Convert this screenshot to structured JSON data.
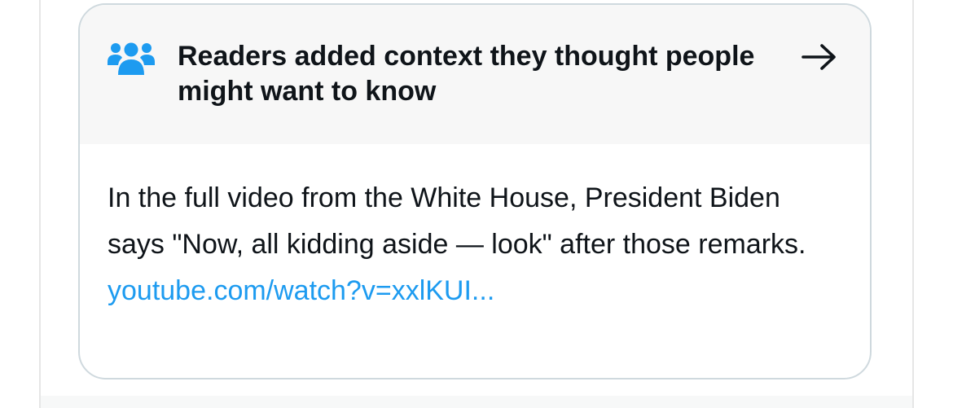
{
  "note": {
    "header_title": "Readers added context they thought people might want to know",
    "header_icon": "people-group-icon",
    "arrow_icon": "arrow-right-icon",
    "body_text": "In the full video from the White House, President Biden says \"Now, all kidding aside — look\" after those remarks.",
    "link_text": "youtube.com/watch?v=xxlKUI..."
  },
  "colors": {
    "icon_blue": "#1d9bf0",
    "link_blue": "#1d9bf0",
    "header_bg": "#f7f7f7",
    "card_border": "#cfd9de",
    "text": "#0f1419"
  }
}
